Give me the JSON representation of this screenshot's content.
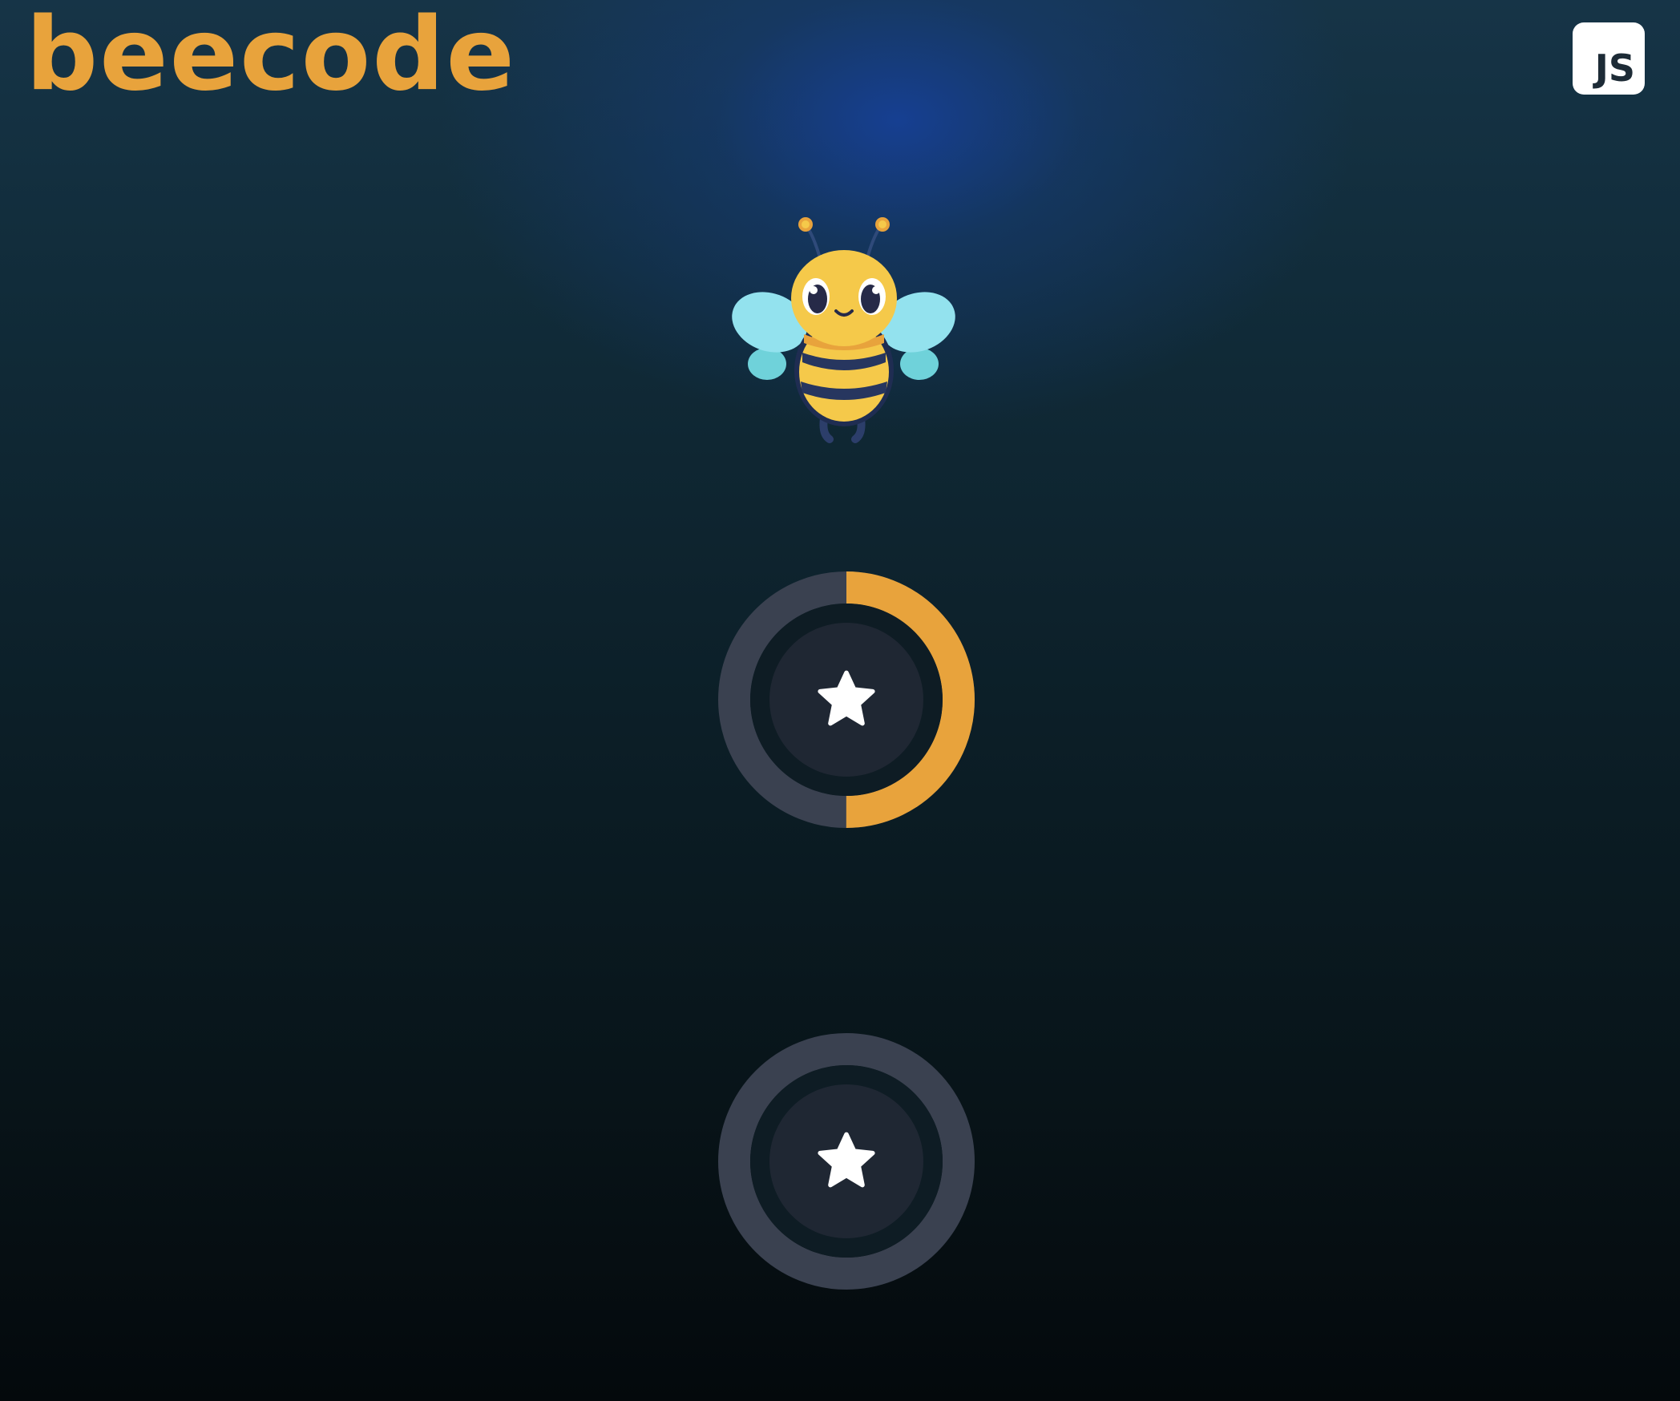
{
  "header": {
    "logo_text": "beecode",
    "language_badge": {
      "label": "JS",
      "icon": "javascript-icon"
    }
  },
  "mascot": {
    "icon": "bee-mascot-icon"
  },
  "learning_path": {
    "levels": [
      {
        "icon": "star-icon",
        "progress": 0.5
      },
      {
        "icon": "star-icon",
        "progress": 0
      }
    ]
  },
  "colors": {
    "accent": "#E8A33C",
    "ring_track": "#3A4150",
    "node_inner": "#1F2733",
    "node_gap": "#0E1C24",
    "star": "#FFFFFF",
    "badge_text": "#1D2B36"
  }
}
